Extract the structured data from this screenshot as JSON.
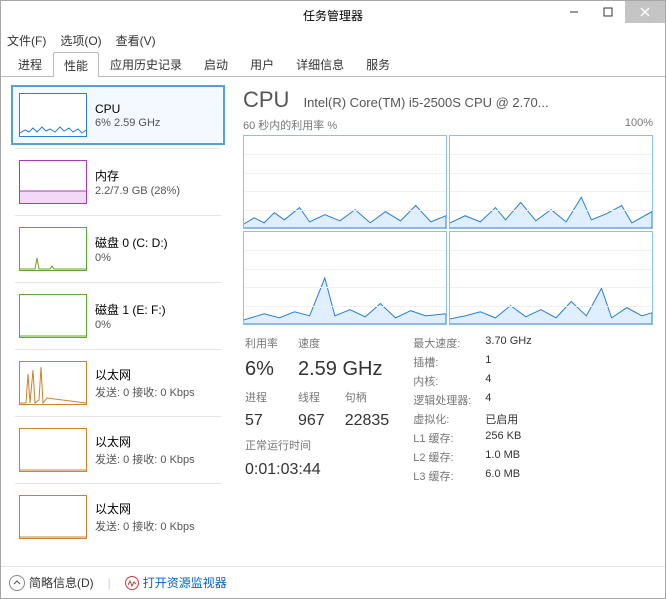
{
  "window": {
    "title": "任务管理器"
  },
  "menu": {
    "file": "文件(F)",
    "options": "选项(O)",
    "view": "查看(V)"
  },
  "tabs": [
    "进程",
    "性能",
    "应用历史记录",
    "启动",
    "用户",
    "详细信息",
    "服务"
  ],
  "sidebar": {
    "items": [
      {
        "title": "CPU",
        "sub": "6% 2.59 GHz",
        "color": "#2a7fd4"
      },
      {
        "title": "内存",
        "sub": "2.2/7.9 GB (28%)",
        "color": "#a63cb5"
      },
      {
        "title": "磁盘 0 (C: D:)",
        "sub": "0%",
        "color": "#5da82c"
      },
      {
        "title": "磁盘 1 (E: F:)",
        "sub": "0%",
        "color": "#5da82c"
      },
      {
        "title": "以太网",
        "sub_prefix": "发送: 0 接收: 0 Kbps",
        "color": "#c9832c"
      },
      {
        "title": "以太网",
        "sub_prefix": "发送: 0 接收: 0 Kbps",
        "color": "#c9832c"
      },
      {
        "title": "以太网",
        "sub_prefix": "发送: 0 接收: 0 Kbps",
        "color": "#c9832c"
      }
    ]
  },
  "main": {
    "heading": "CPU",
    "model": "Intel(R) Core(TM) i5-2500S CPU @ 2.70...",
    "chart_top_left": "60 秒内的利用率 %",
    "chart_top_right": "100%"
  },
  "stats": {
    "util_lbl": "利用率",
    "util_val": "6%",
    "speed_lbl": "速度",
    "speed_val": "2.59 GHz",
    "proc_lbl": "进程",
    "proc_val": "57",
    "thread_lbl": "线程",
    "thread_val": "967",
    "handle_lbl": "句柄",
    "handle_val": "22835",
    "uptime_lbl": "正常运行时间",
    "uptime_val": "0:01:03:44",
    "max_lbl": "最大速度:",
    "max_val": "3.70 GHz",
    "sockets_lbl": "插槽:",
    "sockets_val": "1",
    "cores_lbl": "内核:",
    "cores_val": "4",
    "lproc_lbl": "逻辑处理器:",
    "lproc_val": "4",
    "virt_lbl": "虚拟化:",
    "virt_val": "已启用",
    "l1_lbl": "L1 缓存:",
    "l1_val": "256 KB",
    "l2_lbl": "L2 缓存:",
    "l2_val": "1.0 MB",
    "l3_lbl": "L3 缓存:",
    "l3_val": "6.0 MB"
  },
  "footer": {
    "fewer": "简略信息(D)",
    "resmon": "打开资源监视器"
  },
  "chart_data": {
    "type": "line",
    "title": "60 秒内的利用率 %",
    "xlabel": "",
    "ylabel": "%",
    "ylim": [
      0,
      100
    ],
    "series_count": 4,
    "note": "Four per-logical-processor utilization sparklines over last 60s; values fluctuate roughly 0–30% with occasional spikes."
  }
}
